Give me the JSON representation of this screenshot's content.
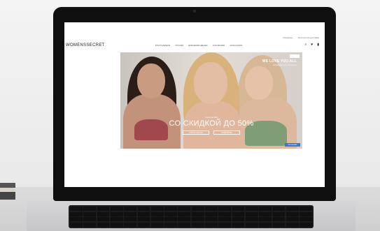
{
  "site": {
    "logo_text": "WOMENSSECRET",
    "utility_links": [
      "Магазины",
      "Бесплатная доставка"
    ],
    "nav_items": [
      "Бюстгальтеры",
      "Трусики",
      "Домашняя одежда",
      "Купальники",
      "Аксессуары"
    ],
    "header_icons": [
      "search-icon",
      "heart-icon",
      "bag-icon"
    ]
  },
  "hero": {
    "promo_title": "WE LOVE YOU ALL",
    "promo_subtitle": "собрание всех весенних",
    "sale_kicker": "только онлайн",
    "sale_headline": "СО СКИДКОЙ ДО 50%",
    "cta_primary": "КУПИТЬ СЕЙЧАС",
    "cta_secondary": "ПОДРОБНЕЕ",
    "chat_label": "Чат онлайн"
  },
  "colors": {
    "chat_button": "#3b78d6",
    "bra_left": "#a0484e",
    "bra_right": "#7f9d76"
  }
}
